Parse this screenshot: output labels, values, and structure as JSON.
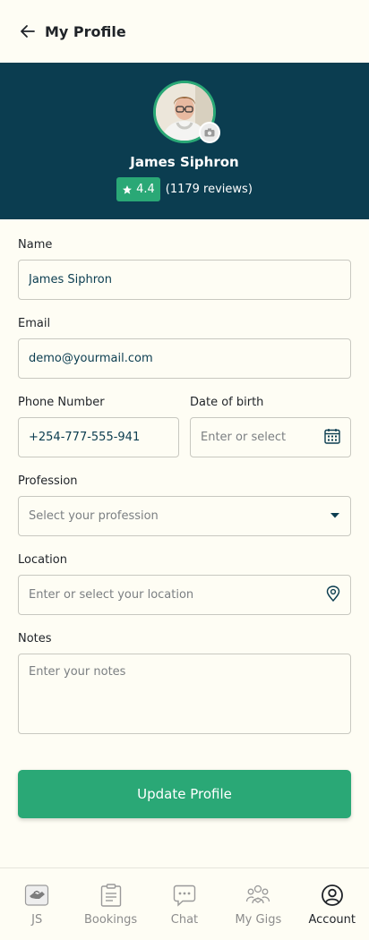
{
  "header": {
    "title": "My Profile"
  },
  "profile": {
    "name": "James Siphron",
    "rating": "4.4",
    "reviews": "(1179 reviews)"
  },
  "form": {
    "name": {
      "label": "Name",
      "value": "James Siphron"
    },
    "email": {
      "label": "Email",
      "value": "demo@yourmail.com"
    },
    "phone": {
      "label": "Phone Number",
      "value": "+254-777-555-941"
    },
    "dob": {
      "label": "Date of birth",
      "placeholder": "Enter or select"
    },
    "profession": {
      "label": "Profession",
      "placeholder": "Select your profession"
    },
    "location": {
      "label": "Location",
      "placeholder": "Enter or select your location"
    },
    "notes": {
      "label": "Notes",
      "placeholder": "Enter your notes"
    }
  },
  "actions": {
    "update_label": "Update Profile"
  },
  "nav": {
    "items": [
      {
        "label": "JS",
        "icon": "handshake-icon"
      },
      {
        "label": "Bookings",
        "icon": "clipboard-icon"
      },
      {
        "label": "Chat",
        "icon": "chat-icon"
      },
      {
        "label": "My Gigs",
        "icon": "team-icon"
      },
      {
        "label": "Account",
        "icon": "account-icon"
      }
    ],
    "active": "Account"
  },
  "colors": {
    "primary": "#2aa876",
    "hero_bg": "#0b3d50",
    "background": "#fefdf4",
    "input_text": "#0b3d50"
  }
}
